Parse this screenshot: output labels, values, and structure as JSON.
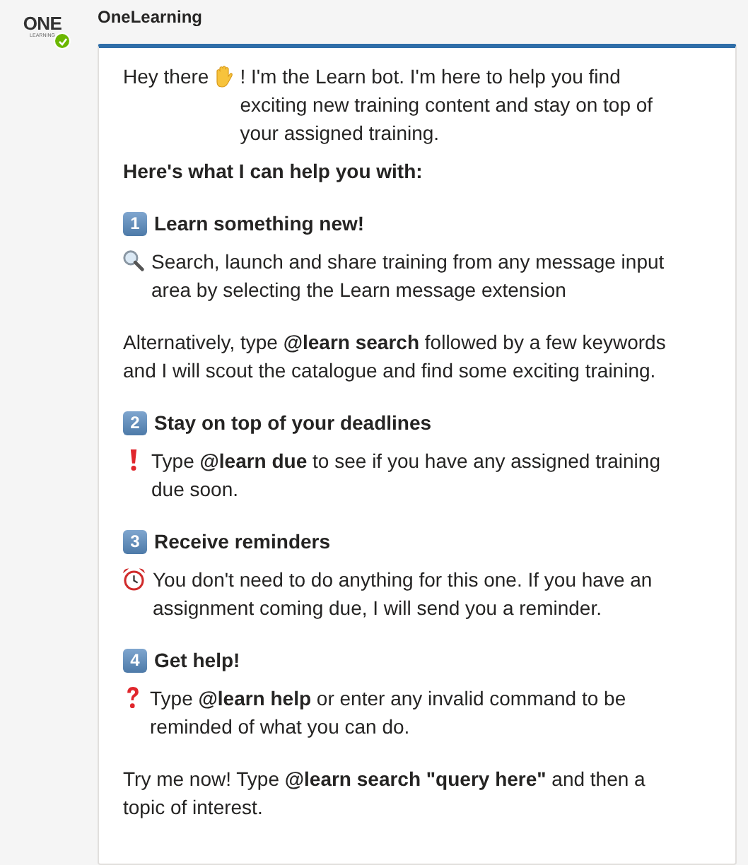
{
  "logo": {
    "main": "ONE",
    "sub": "LEARNING",
    "online": true
  },
  "sender": "OneLearning",
  "message": [
    {
      "kind": "intro",
      "before": "Hey there",
      "text": "! I'm the Learn bot. I'm here to help you find exciting new training content and stay on top of your assigned training."
    },
    {
      "kind": "heading",
      "text": "Here's what I can help you with:"
    },
    {
      "kind": "numbered",
      "number": "1",
      "text": "Learn something new!"
    },
    {
      "kind": "search_tip",
      "text": "Search, launch and share training from any message input area by selecting the Learn message extension"
    },
    {
      "kind": "text",
      "text": "Alternatively, type **@learn search** followed by a few keywords and I will scout the catalogue and find some exciting training."
    },
    {
      "kind": "numbered",
      "number": "2",
      "text": "Stay on top of your deadlines"
    },
    {
      "kind": "due_tip",
      "text": "Type **@learn due** to see if you have any assigned training due soon."
    },
    {
      "kind": "numbered",
      "number": "3",
      "text": "Receive reminders"
    },
    {
      "kind": "reminder_tip",
      "text": "You don't need to do anything for this one. If you have an assignment coming due, I will send you a reminder."
    },
    {
      "kind": "numbered",
      "number": "4",
      "text": "Get help!"
    },
    {
      "kind": "help_tip",
      "text": "Type **@learn help** or enter any invalid command to be reminded of what you can do."
    },
    {
      "kind": "text",
      "text": "Try me now! Type **@learn search \"query here\"** and then a topic of interest."
    }
  ]
}
